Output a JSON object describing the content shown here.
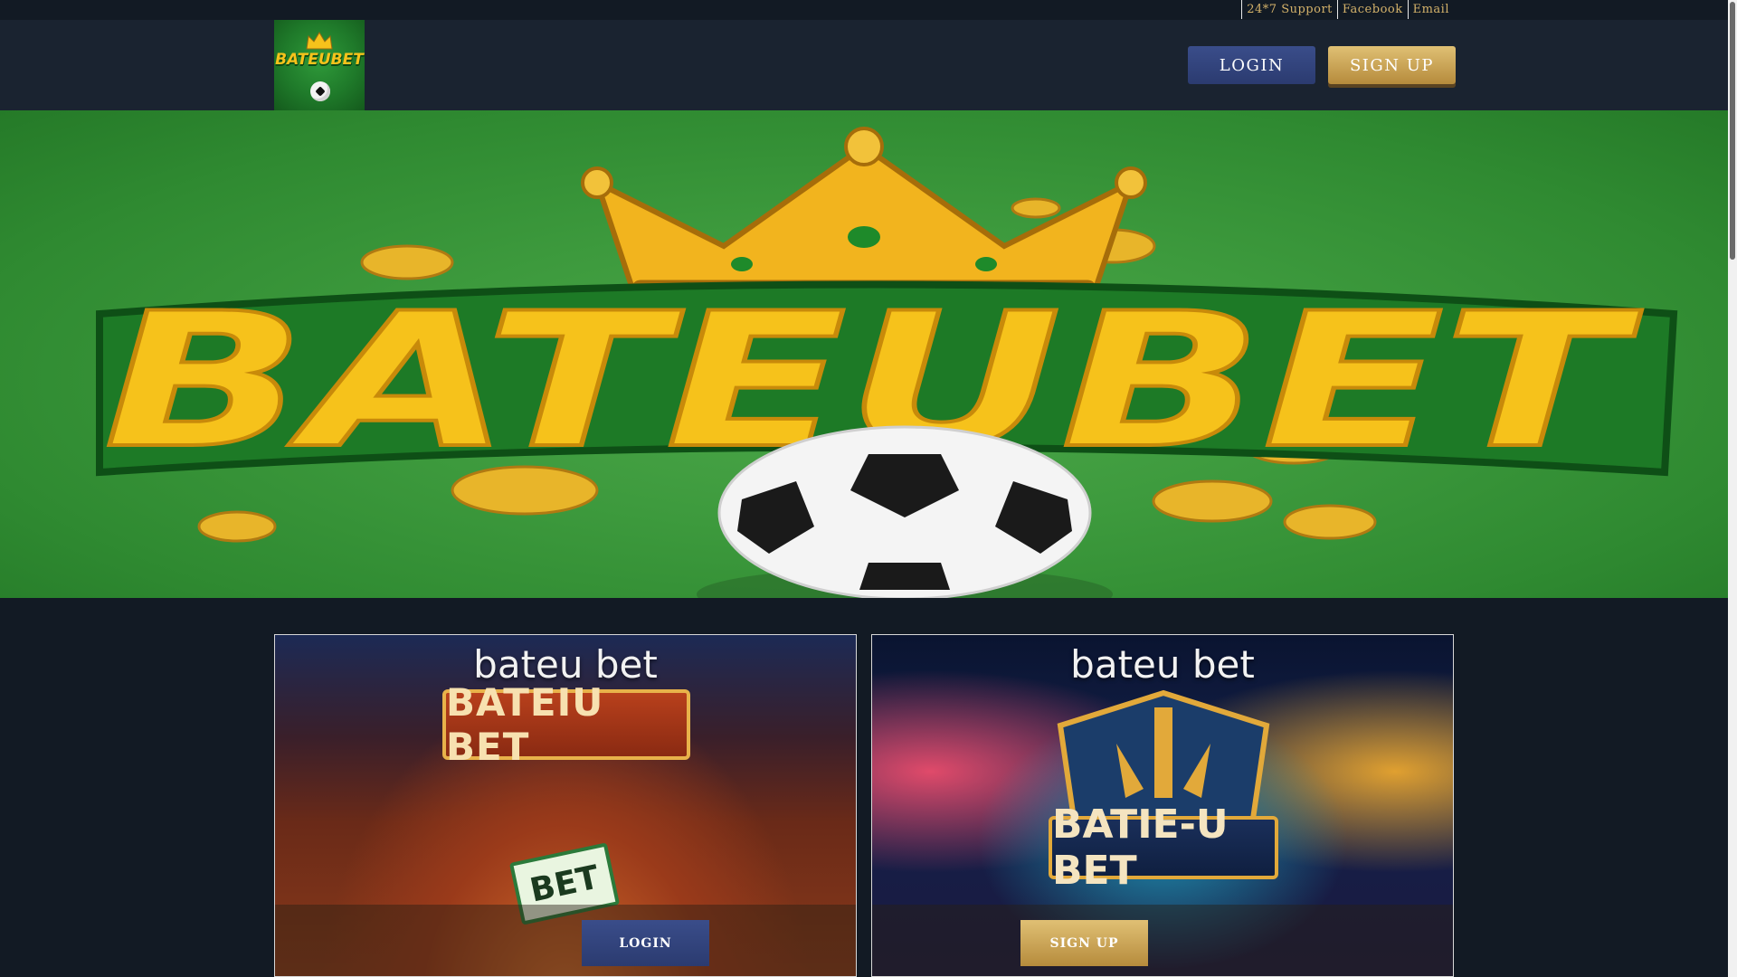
{
  "topbar": {
    "links": [
      "24*7 Support",
      "Facebook",
      "Email"
    ]
  },
  "header": {
    "logo_text": "BATEUBET",
    "login_label": "LOGIN",
    "signup_label": "SIGN UP"
  },
  "hero": {
    "banner_text": "BATEUBET"
  },
  "cards": [
    {
      "brand": "bateu bet",
      "sign_text": "BATEIU BET",
      "box_text": "BET",
      "button_label": "LOGIN"
    },
    {
      "brand": "bateu bet",
      "badge_text": "BATIE-U BET",
      "button_label": "SIGN UP"
    }
  ],
  "colors": {
    "gold": "#d4b26a",
    "login_blue": "#2f4078",
    "signup_gold": "#c9a352",
    "hero_green": "#3d9a3d",
    "banner_yellow": "#f6c21b"
  }
}
